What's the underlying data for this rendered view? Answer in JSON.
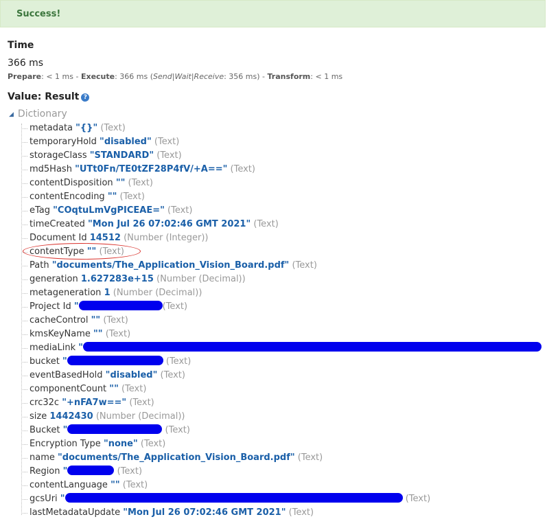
{
  "banner": {
    "text": "Success!"
  },
  "timing": {
    "heading": "Time",
    "total": "366 ms",
    "prepare_label": "Prepare",
    "prepare_value": ": < 1 ms - ",
    "execute_label": "Execute",
    "execute_value": ": 366 ms (",
    "execute_detail": "Send|Wait|Receive",
    "execute_detail_value": ": 356 ms) - ",
    "transform_label": "Transform",
    "transform_value": ": < 1 ms"
  },
  "value": {
    "heading": "Value: Result",
    "root_label": "Dictionary"
  },
  "rows": [
    {
      "key": "metadata",
      "value": "\"{}\"",
      "type": "(Text)"
    },
    {
      "key": "temporaryHold",
      "value": "\"disabled\"",
      "type": "(Text)"
    },
    {
      "key": "storageClass",
      "value": "\"STANDARD\"",
      "type": "(Text)"
    },
    {
      "key": "md5Hash",
      "value": "\"UTt0Fn/TE0tZF28P4fV/+A==\"",
      "type": "(Text)"
    },
    {
      "key": "contentDisposition",
      "value": "\"\"",
      "type": "(Text)"
    },
    {
      "key": "contentEncoding",
      "value": "\"\"",
      "type": "(Text)"
    },
    {
      "key": "eTag",
      "value": "\"COqtuLmVgPICEAE=\"",
      "type": "(Text)"
    },
    {
      "key": "timeCreated",
      "value": "\"Mon Jul 26 07:02:46 GMT 2021\"",
      "type": "(Text)"
    },
    {
      "key": "Document Id",
      "value": "14512",
      "type": "(Number (Integer))"
    },
    {
      "key": "contentType",
      "value": "\"\"",
      "type": "(Text)"
    },
    {
      "key": "Path",
      "value": "\"documents/The_Application_Vision_Board.pdf\"",
      "type": "(Text)"
    },
    {
      "key": "generation",
      "value": "1.627283e+15",
      "type": "(Number (Decimal))"
    },
    {
      "key": "metageneration",
      "value": "1",
      "type": "(Number (Decimal))"
    },
    {
      "key": "Project Id",
      "value": "\"",
      "type": "(Text)"
    },
    {
      "key": "cacheControl",
      "value": "\"\"",
      "type": "(Text)"
    },
    {
      "key": "kmsKeyName",
      "value": "\"\"",
      "type": "(Text)"
    },
    {
      "key": "mediaLink",
      "value": "\"",
      "type": ""
    },
    {
      "key": "bucket",
      "value": "\"",
      "type": "(Text)"
    },
    {
      "key": "eventBasedHold",
      "value": "\"disabled\"",
      "type": "(Text)"
    },
    {
      "key": "componentCount",
      "value": "\"\"",
      "type": "(Text)"
    },
    {
      "key": "crc32c",
      "value": "\"+nFA7w==\"",
      "type": "(Text)"
    },
    {
      "key": "size",
      "value": "1442430",
      "type": "(Number (Decimal))"
    },
    {
      "key": "Bucket",
      "value": "\"",
      "type": "(Text)"
    },
    {
      "key": "Encryption Type",
      "value": "\"none\"",
      "type": "(Text)"
    },
    {
      "key": "name",
      "value": "\"documents/The_Application_Vision_Board.pdf\"",
      "type": "(Text)"
    },
    {
      "key": "Region",
      "value": "\"",
      "type": "(Text)"
    },
    {
      "key": "contentLanguage",
      "value": "\"\"",
      "type": "(Text)"
    },
    {
      "key": "gcsUri",
      "value": "\"",
      "type": "(Text)"
    },
    {
      "key": "lastMetadataUpdate",
      "value": "\"Mon Jul 26 07:02:46 GMT 2021\"",
      "type": "(Text)"
    }
  ],
  "colors": {
    "success_bg": "#dff0d8",
    "success_text": "#3c763d",
    "value_text": "#1a5fa8",
    "type_text": "#999999",
    "redaction": "#0000ee",
    "annotation_circle": "#d9302a"
  }
}
